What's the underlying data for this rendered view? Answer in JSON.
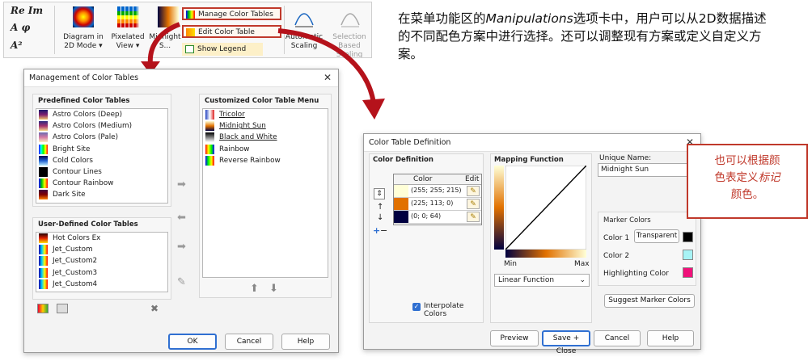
{
  "ribbon": {
    "small_buttons": [
      "Re Im",
      "Α φ",
      "A²"
    ],
    "diagram_2d": [
      "Diagram in",
      "2D Mode ▾"
    ],
    "pixelated": [
      "Pixelated",
      "View ▾"
    ],
    "midnight": [
      "Midnight",
      "S..."
    ],
    "manage_color_tables": "Manage Color Tables",
    "edit_color_table": "Edit Color Table",
    "show_legend": "Show Legend",
    "automatic_scaling": [
      "Automatic",
      "Scaling"
    ],
    "selection_scaling": [
      "Selection",
      "Based Scaling"
    ]
  },
  "description": {
    "before": "在菜单功能区的",
    "italic": "Manipulations",
    "after": "选项卡中，用户可以从2D数据描述的不同配色方案中进行选择。还可以调整现有方案或定义自定义方案。"
  },
  "management_dialog": {
    "title": "Management of Color Tables",
    "predefined_title": "Predefined Color Tables",
    "predefined": [
      {
        "label": "Astro Colors (Deep)",
        "sw": "linear-gradient(#1a1a6e,#7c1d6f,#f0c36b)"
      },
      {
        "label": "Astro Colors (Medium)",
        "sw": "linear-gradient(#2b2b80,#a5326e,#f5d88b)"
      },
      {
        "label": "Astro Colors (Pale)",
        "sw": "linear-gradient(#6a6ab0,#d57aa4,#fbeec0)"
      },
      {
        "label": "Bright Site",
        "sw": "linear-gradient(90deg,#00f,#0ff,#0f0,#ff0,#f00)"
      },
      {
        "label": "Cold Colors",
        "sw": "linear-gradient(#000050,#2060d0,#c0f0ff)"
      },
      {
        "label": "Contour Lines",
        "sw": "linear-gradient(#000,#000)"
      },
      {
        "label": "Contour Rainbow",
        "sw": "linear-gradient(90deg,#00f,#0c0,#ff0,#f00)"
      },
      {
        "label": "Dark Site",
        "sw": "linear-gradient(#400040,#800000,#ff8000)"
      }
    ],
    "user_title": "User-Defined Color Tables",
    "user": [
      {
        "label": "Hot Colors Ex",
        "sw": "linear-gradient(#200000,#e02000,#ffe000)"
      },
      {
        "label": "Jet_Custom",
        "sw": "linear-gradient(90deg,#00a,#0cf,#ff0,#f00)"
      },
      {
        "label": "Jet_Custom2",
        "sw": "linear-gradient(90deg,#00a,#0cf,#ff0,#f00)"
      },
      {
        "label": "Jet_Custom3",
        "sw": "linear-gradient(90deg,#00a,#0cf,#ff0,#f00)"
      },
      {
        "label": "Jet_Custom4",
        "sw": "linear-gradient(90deg,#00a,#0cf,#ff0,#f00)"
      }
    ],
    "custom_title": "Customized Color Table Menu",
    "custom": [
      {
        "label": "Tricolor",
        "sw": "linear-gradient(90deg,#1f3fbf,#fff,#d22)",
        "underline": true
      },
      {
        "label": "Midnight Sun",
        "sw": "linear-gradient(#fffed7,#e17100,#000040)",
        "underline": true
      },
      {
        "label": "Black and White",
        "sw": "linear-gradient(#000,#fff)",
        "underline": true
      },
      {
        "label": "Rainbow",
        "sw": "linear-gradient(90deg,#f00,#ff0,#0f0,#00f)",
        "underline": false
      },
      {
        "label": "Reverse Rainbow",
        "sw": "linear-gradient(90deg,#00f,#0f0,#ff0,#f00)",
        "underline": false
      }
    ],
    "ok": "OK",
    "cancel": "Cancel",
    "help": "Help"
  },
  "definition_dialog": {
    "title": "Color Table Definition",
    "color_definition_title": "Color Definition",
    "col_color": "Color",
    "col_edit": "Edit",
    "rows": [
      {
        "rgb": "(255; 255; 215)",
        "hex": "#ffffd7"
      },
      {
        "rgb": "(225; 113; 0)",
        "hex": "#e17100"
      },
      {
        "rgb": "(0; 0; 64)",
        "hex": "#000040"
      }
    ],
    "interpolate": "Interpolate Colors",
    "mapping_title": "Mapping Function",
    "min": "Min",
    "max": "Max",
    "linear_function": "Linear Function",
    "unique_name_label": "Unique Name:",
    "unique_name_value": "Midnight Sun",
    "marker_colors_title": "Marker Colors",
    "color1": "Color 1",
    "transparent": "Transparent",
    "color2": "Color 2",
    "highlighting": "Highlighting Color",
    "suggest": "Suggest Marker Colors",
    "preview": "Preview",
    "save_close": "Save + Close",
    "cancel": "Cancel",
    "help": "Help",
    "marker_color1_hex": "#000000",
    "marker_color2_hex": "#a7f3f5",
    "highlight_hex": "#f0117a"
  },
  "callout": {
    "line1": "也可以根据颜",
    "line2a": "色表定义",
    "line2b": "标记",
    "line3": "颜色。"
  },
  "accent_red": "#b5121b"
}
